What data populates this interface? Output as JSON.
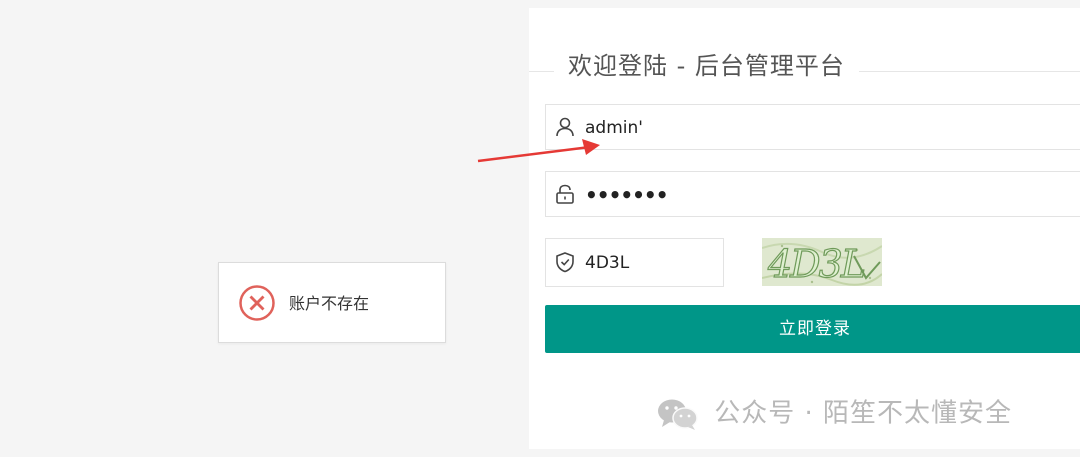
{
  "login": {
    "title": "欢迎登陆 - 后台管理平台",
    "username": {
      "value": "admin'",
      "icon": "user-icon"
    },
    "password": {
      "value": "•••••••",
      "icon": "lock-icon"
    },
    "captcha": {
      "value": "4D3L",
      "icon": "shield-check-icon",
      "image_text": "4D3L"
    },
    "submit_label": "立即登录"
  },
  "toast": {
    "message": "账户不存在",
    "icon": "error-circle-icon",
    "color": "#e0625b"
  },
  "annotation": {
    "arrow_color": "#e53935"
  },
  "watermark": {
    "text": "公众号 · 陌笙不太懂安全",
    "icon": "wechat-icon"
  },
  "colors": {
    "accent": "#009688",
    "background": "#f5f5f5"
  }
}
